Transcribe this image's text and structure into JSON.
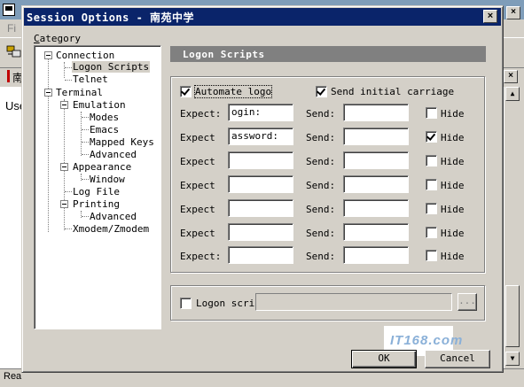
{
  "background_app": {
    "menu_partial": "Fi",
    "tab_partial": "南",
    "terminal_partial": "Use",
    "status_partial": "Rea"
  },
  "dialog": {
    "title": "Session Options - 南苑中学",
    "close_glyph": "×"
  },
  "category": {
    "label": "Category",
    "tree": [
      {
        "label": "Connection"
      },
      {
        "label": "Logon Scripts",
        "selected": true
      },
      {
        "label": "Telnet"
      },
      {
        "label": "Terminal"
      },
      {
        "label": "Emulation"
      },
      {
        "label": "Modes"
      },
      {
        "label": "Emacs"
      },
      {
        "label": "Mapped Keys"
      },
      {
        "label": "Advanced"
      },
      {
        "label": "Appearance"
      },
      {
        "label": "Window"
      },
      {
        "label": "Log File"
      },
      {
        "label": "Printing"
      },
      {
        "label": "Advanced"
      },
      {
        "label": "Xmodem/Zmodem"
      }
    ]
  },
  "section": {
    "header": "Logon Scripts"
  },
  "logon": {
    "automate_label": "Automate logo",
    "automate_checked": true,
    "send_cr_label": "Send initial carriage",
    "send_cr_checked": true,
    "rows": [
      {
        "expect_label": "Expect:",
        "expect_value": "ogin:",
        "send_label": "Send:",
        "send_value": "",
        "hide_label": "Hide",
        "hide_checked": false
      },
      {
        "expect_label": "Expect",
        "expect_value": "assword:",
        "send_label": "Send:",
        "send_value": "",
        "hide_label": "Hide",
        "hide_checked": true
      },
      {
        "expect_label": "Expect",
        "expect_value": "",
        "send_label": "Send:",
        "send_value": "",
        "hide_label": "Hide",
        "hide_checked": false
      },
      {
        "expect_label": "Expect",
        "expect_value": "",
        "send_label": "Send:",
        "send_value": "",
        "hide_label": "Hide",
        "hide_checked": false
      },
      {
        "expect_label": "Expect",
        "expect_value": "",
        "send_label": "Send:",
        "send_value": "",
        "hide_label": "Hide",
        "hide_checked": false
      },
      {
        "expect_label": "Expect",
        "expect_value": "",
        "send_label": "Send:",
        "send_value": "",
        "hide_label": "Hide",
        "hide_checked": false
      },
      {
        "expect_label": "Expect:",
        "expect_value": "",
        "send_label": "Send:",
        "send_value": "",
        "hide_label": "Hide",
        "hide_checked": false
      }
    ],
    "script_label": "Logon scrip",
    "script_checked": false,
    "browse_label": "..."
  },
  "buttons": {
    "ok": "OK",
    "cancel": "Cancel"
  },
  "watermark_text": "IT168.com"
}
